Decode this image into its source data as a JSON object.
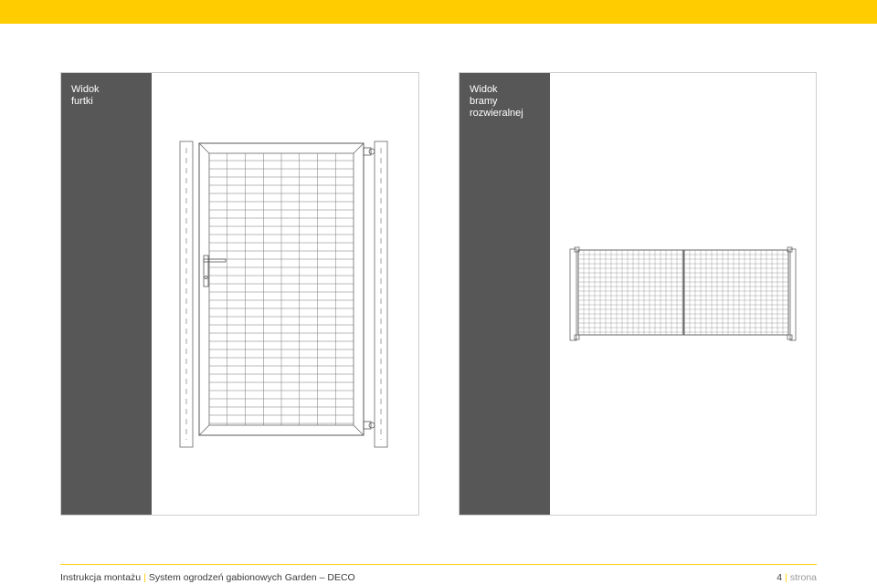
{
  "colors": {
    "accent": "#ffcc00",
    "sidebar": "#575757",
    "line": "#555555"
  },
  "panels": {
    "wicket": {
      "title_line1": "Widok",
      "title_line2": "furtki"
    },
    "gate": {
      "title_line1": "Widok",
      "title_line2": "bramy",
      "title_line3": "rozwieralnej"
    }
  },
  "footer": {
    "manual": "Instrukcja montażu",
    "separator": "|",
    "system": "System ogrodzeń gabionowych Garden – DECO",
    "page_number": "4",
    "page_label": "strona"
  }
}
